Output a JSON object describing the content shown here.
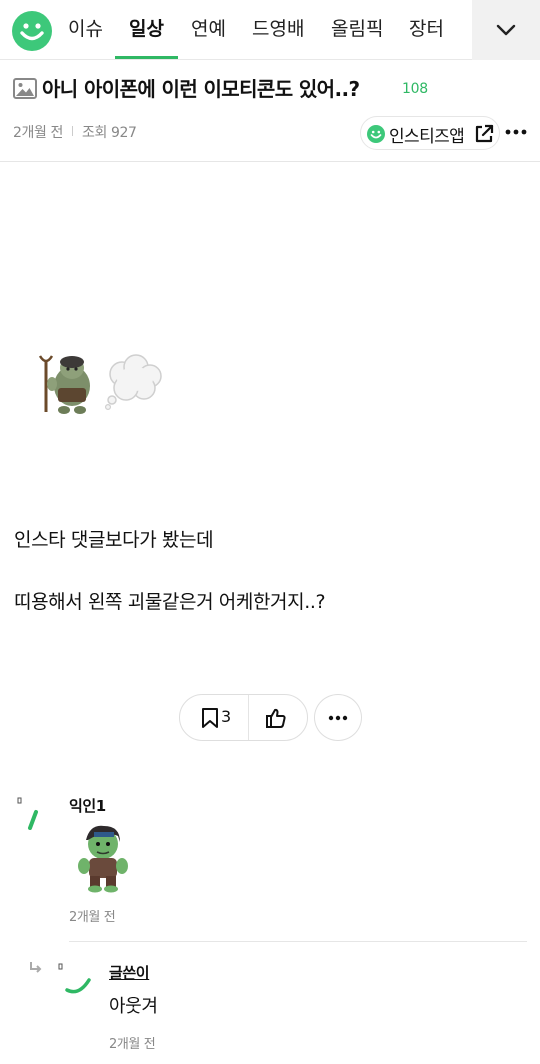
{
  "nav": {
    "tabs": [
      {
        "label": "이슈"
      },
      {
        "label": "일상"
      },
      {
        "label": "연예"
      },
      {
        "label": "드영배"
      },
      {
        "label": "올림픽"
      },
      {
        "label": "장터"
      }
    ],
    "active_tab": "일상"
  },
  "post": {
    "title": "아니 아이폰에 이런 이모티콘도 있어..?",
    "reply_count": "108",
    "time": "2개월 전",
    "views": "조회 927",
    "app_button_label": "인스티즈앱",
    "body_lines": [
      "인스타 댓글보다가 봤는데",
      "띠용해서 왼쪽 괴물같은거 어케한거지..?"
    ],
    "bookmark_count": "3"
  },
  "comments": [
    {
      "name": "익인1",
      "time": "2개월 전",
      "text": ""
    },
    {
      "name": "글쓴이",
      "time": "2개월 전",
      "text": "아웃겨",
      "is_reply": true
    }
  ],
  "colors": {
    "brand_green": "#3dc87a",
    "accent_green": "#2fb864",
    "muted_text": "#888888"
  },
  "icons": [
    "smile-logo-icon",
    "chevron-down-icon",
    "image-icon",
    "external-link-icon",
    "more-dots-icon",
    "bookmark-icon",
    "thumbs-up-icon",
    "reply-arrow-icon"
  ]
}
